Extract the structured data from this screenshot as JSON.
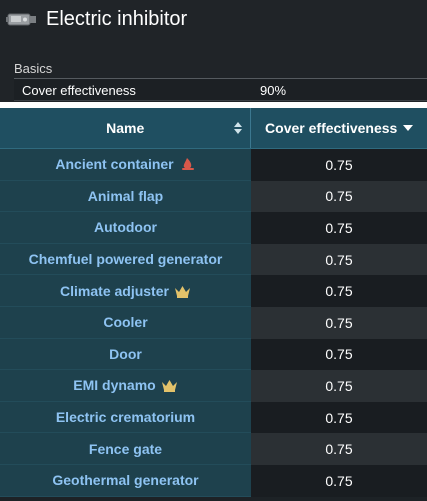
{
  "page": {
    "title": "Electric inhibitor",
    "title_icon": "device-icon"
  },
  "basics": {
    "section_label": "Basics",
    "property_label": "Cover effectiveness",
    "property_value": "90%"
  },
  "table": {
    "headers": {
      "name": "Name",
      "cover": "Cover effectiveness"
    },
    "sort": {
      "column": "cover",
      "direction": "desc"
    },
    "colors": {
      "header_bg": "#1f4f61",
      "name_cell_bg": "#1e414d",
      "name_text": "#8ec3f2",
      "crown": "#e3c26a",
      "flame": "#d7584a"
    },
    "rows": [
      {
        "name": "Ancient container",
        "value": "0.75",
        "badge": "flame-icon"
      },
      {
        "name": "Animal flap",
        "value": "0.75",
        "badge": ""
      },
      {
        "name": "Autodoor",
        "value": "0.75",
        "badge": ""
      },
      {
        "name": "Chemfuel powered generator",
        "value": "0.75",
        "badge": ""
      },
      {
        "name": "Climate adjuster",
        "value": "0.75",
        "badge": "crown-icon"
      },
      {
        "name": "Cooler",
        "value": "0.75",
        "badge": ""
      },
      {
        "name": "Door",
        "value": "0.75",
        "badge": ""
      },
      {
        "name": "EMI dynamo",
        "value": "0.75",
        "badge": "crown-icon"
      },
      {
        "name": "Electric crematorium",
        "value": "0.75",
        "badge": ""
      },
      {
        "name": "Fence gate",
        "value": "0.75",
        "badge": ""
      },
      {
        "name": "Geothermal generator",
        "value": "0.75",
        "badge": ""
      }
    ]
  }
}
